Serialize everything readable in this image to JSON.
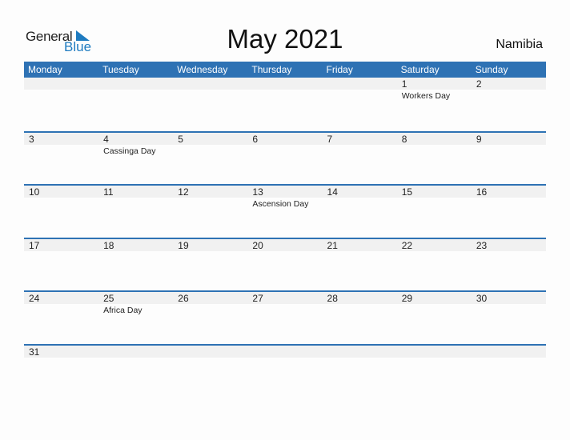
{
  "logo": {
    "general": "General",
    "blue": "Blue"
  },
  "title": "May 2021",
  "country": "Namibia",
  "colors": {
    "header": "#2e72b4",
    "band": "#f1f1f1",
    "brand_blue": "#1e7bc0"
  },
  "weekdays": [
    "Monday",
    "Tuesday",
    "Wednesday",
    "Thursday",
    "Friday",
    "Saturday",
    "Sunday"
  ],
  "weeks": [
    [
      {
        "day": ""
      },
      {
        "day": ""
      },
      {
        "day": ""
      },
      {
        "day": ""
      },
      {
        "day": ""
      },
      {
        "day": "1",
        "holiday": "Workers Day"
      },
      {
        "day": "2"
      }
    ],
    [
      {
        "day": "3"
      },
      {
        "day": "4",
        "holiday": "Cassinga Day"
      },
      {
        "day": "5"
      },
      {
        "day": "6"
      },
      {
        "day": "7"
      },
      {
        "day": "8"
      },
      {
        "day": "9"
      }
    ],
    [
      {
        "day": "10"
      },
      {
        "day": "11"
      },
      {
        "day": "12"
      },
      {
        "day": "13",
        "holiday": "Ascension Day"
      },
      {
        "day": "14"
      },
      {
        "day": "15"
      },
      {
        "day": "16"
      }
    ],
    [
      {
        "day": "17"
      },
      {
        "day": "18"
      },
      {
        "day": "19"
      },
      {
        "day": "20"
      },
      {
        "day": "21"
      },
      {
        "day": "22"
      },
      {
        "day": "23"
      }
    ],
    [
      {
        "day": "24"
      },
      {
        "day": "25",
        "holiday": "Africa Day"
      },
      {
        "day": "26"
      },
      {
        "day": "27"
      },
      {
        "day": "28"
      },
      {
        "day": "29"
      },
      {
        "day": "30"
      }
    ],
    [
      {
        "day": "31"
      },
      {
        "day": ""
      },
      {
        "day": ""
      },
      {
        "day": ""
      },
      {
        "day": ""
      },
      {
        "day": ""
      },
      {
        "day": ""
      }
    ]
  ]
}
